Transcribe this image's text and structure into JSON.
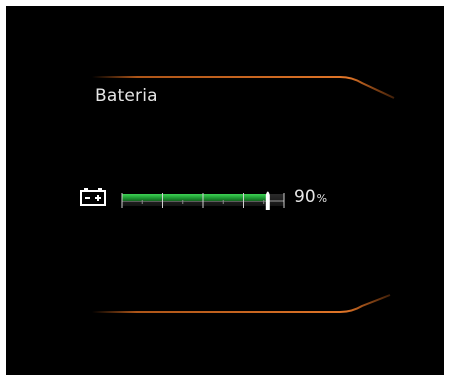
{
  "screen": {
    "title": "Bateria",
    "accent_color": "#d86a1e"
  },
  "battery": {
    "icon": "battery-icon",
    "level_percent": 90,
    "value_text": "90",
    "unit_text": "%",
    "segments_total": 4,
    "fill_color": "#22a83a"
  }
}
